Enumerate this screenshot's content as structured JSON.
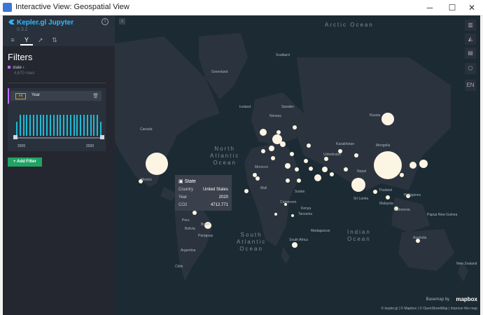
{
  "window": {
    "title": "Interactive View: Geospatial View",
    "minimize": "─",
    "maximize": "☐",
    "close": "✕"
  },
  "sidebar": {
    "brand": "Kepler.gl Jupyter",
    "version": "0.3.2",
    "panel_title": "Filters",
    "dataset_name": "state",
    "dataset_rows": "4,670 rows",
    "filter": {
      "type_tag": "int",
      "field": "Year",
      "range_min": "2020",
      "range_max": "2020"
    },
    "add_filter_label": "+ Add Filter"
  },
  "map": {
    "oceans": {
      "arctic": "Arctic Ocean",
      "north_atlantic": "North\nAtlantic\nOcean",
      "south_atlantic": "South\nAtlantic\nOcean",
      "indian": "Indian\nOcean"
    },
    "countries": [
      "Svalbard",
      "Greenland",
      "Iceland",
      "Sweden",
      "Norway",
      "Canada",
      "Russia",
      "Kazakhstan",
      "Uzbekistan",
      "Mongolia",
      "Mexico",
      "Morocco",
      "Mali",
      "Sudan",
      "Nepal",
      "Sri Lanka",
      "Thailand",
      "Philippines",
      "Malaysia",
      "Indonesia",
      "Papua New Guinea",
      "Cameroon",
      "Kenya",
      "Tanzania",
      "Madagascar",
      "South Africa",
      "Australia",
      "Peru",
      "Brazil",
      "Bolivia",
      "Paraguay",
      "Argentina",
      "New Zealand",
      "Chile"
    ],
    "tooltip": {
      "title": "State",
      "rows": [
        {
          "k": "Country",
          "v": "United States"
        },
        {
          "k": "Year",
          "v": "2020"
        },
        {
          "k": "CO2",
          "v": "4712.771"
        }
      ]
    },
    "controls": [
      "layers",
      "3d",
      "legend",
      "draw",
      "EN"
    ],
    "attribution_based": "Basemap by",
    "mapbox": "mapbox",
    "attribution": "© kepler.gl | © Mapbox | © OpenStreetMap | Improve this map",
    "colors": {
      "land": "#2b343e",
      "ocean": "#1c2a33",
      "bubble": "#fdf5e4",
      "accent": "#1fbad6"
    }
  }
}
